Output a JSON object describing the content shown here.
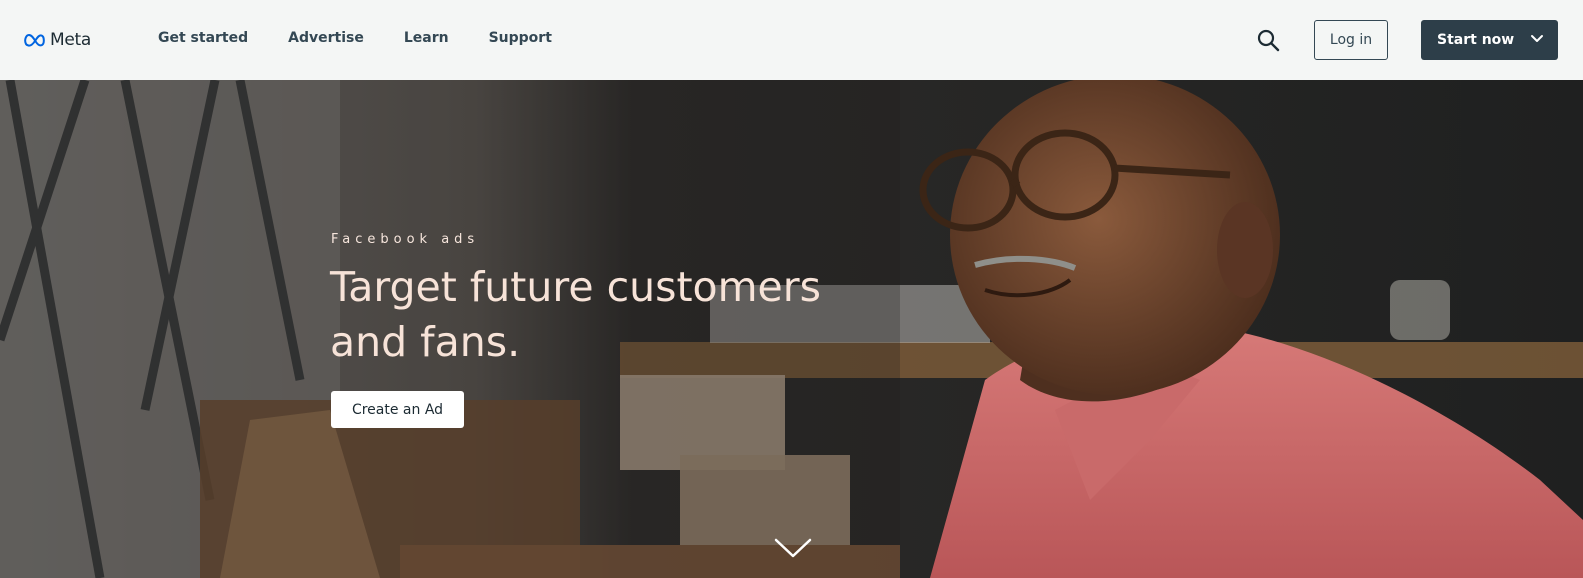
{
  "header": {
    "logo_text": "Meta",
    "nav": [
      "Get started",
      "Advertise",
      "Learn",
      "Support"
    ],
    "login_label": "Log in",
    "start_label": "Start now",
    "icons": [
      "meta-infinity-icon",
      "search-icon",
      "chevron-down-icon"
    ]
  },
  "hero": {
    "eyebrow": "Facebook ads",
    "headline": "Target future customers and fans.",
    "cta_label": "Create an Ad",
    "scroll_icon": "chevron-down-icon"
  },
  "colors": {
    "header_bg": "#f4f6f5",
    "nav_text": "#344854",
    "primary_button": "#2d3e49",
    "meta_blue": "#0064e0",
    "headline_text": "#f7e3d8"
  }
}
